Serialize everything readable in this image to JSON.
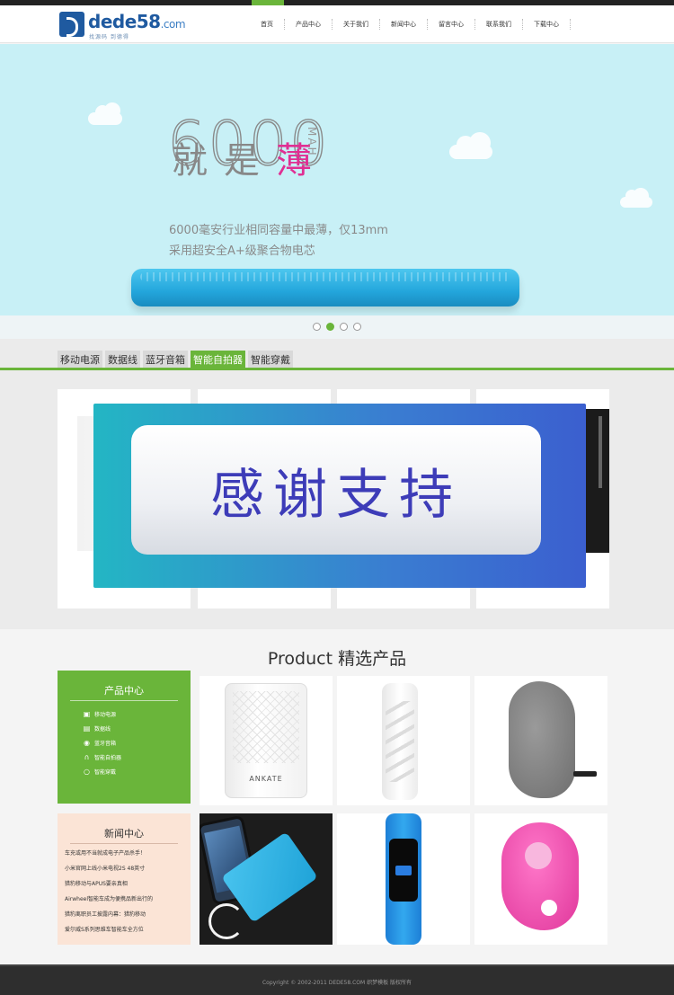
{
  "header": {
    "logo_text": "dede58",
    "logo_suffix": ".com",
    "logo_slogan": "找源码 到德得",
    "nav": [
      "首页",
      "产品中心",
      "关于我们",
      "新闻中心",
      "留言中心",
      "联系我们",
      "下载中心"
    ]
  },
  "banner": {
    "big_number": "6000",
    "headline": [
      "就",
      "是",
      "薄"
    ],
    "unit": "MAH",
    "line1": "6000毫安行业相同容量中最薄，仅13mm",
    "line2": "采用超安全A+级聚合物电芯",
    "slides_total": 4,
    "slide_active": 2
  },
  "tabs": {
    "items": [
      "移动电源",
      "数据线",
      "蓝牙音箱",
      "智能自拍器",
      "智能穿戴"
    ],
    "active_index": 3
  },
  "overlay": {
    "text": "感谢支持"
  },
  "products": {
    "title": "Product 精选产品",
    "side_title": "产品中心",
    "side_items": [
      {
        "label": "移动电源",
        "icon": "battery-icon"
      },
      {
        "label": "数据线",
        "icon": "cable-icon"
      },
      {
        "label": "蓝牙音箱",
        "icon": "speaker-icon"
      },
      {
        "label": "智能自拍器",
        "icon": "headphone-icon"
      },
      {
        "label": "智能穿戴",
        "icon": "ring-icon"
      }
    ],
    "thumb_brand": "ANKATE"
  },
  "news": {
    "title": "新闻中心",
    "items": [
      "车充或用不当就成电子产品杀手！",
      "小米官网上线小米电视2S 48英寸",
      "猎豹移动与APUS要亲真相",
      "Airwheel智能车成为便携品新出行的",
      "猎豹离职员工披露内幕：猎豹移动",
      "爱尔威S系列思维车智能车全方位"
    ]
  },
  "footer": {
    "copyright": "Copyright © 2002-2011 DEDE58.COM 织梦模板 版权所有"
  },
  "colors": {
    "accent": "#6ab53a",
    "banner_bg": "#c8f0f6",
    "headline_pink": "#e02f93"
  }
}
